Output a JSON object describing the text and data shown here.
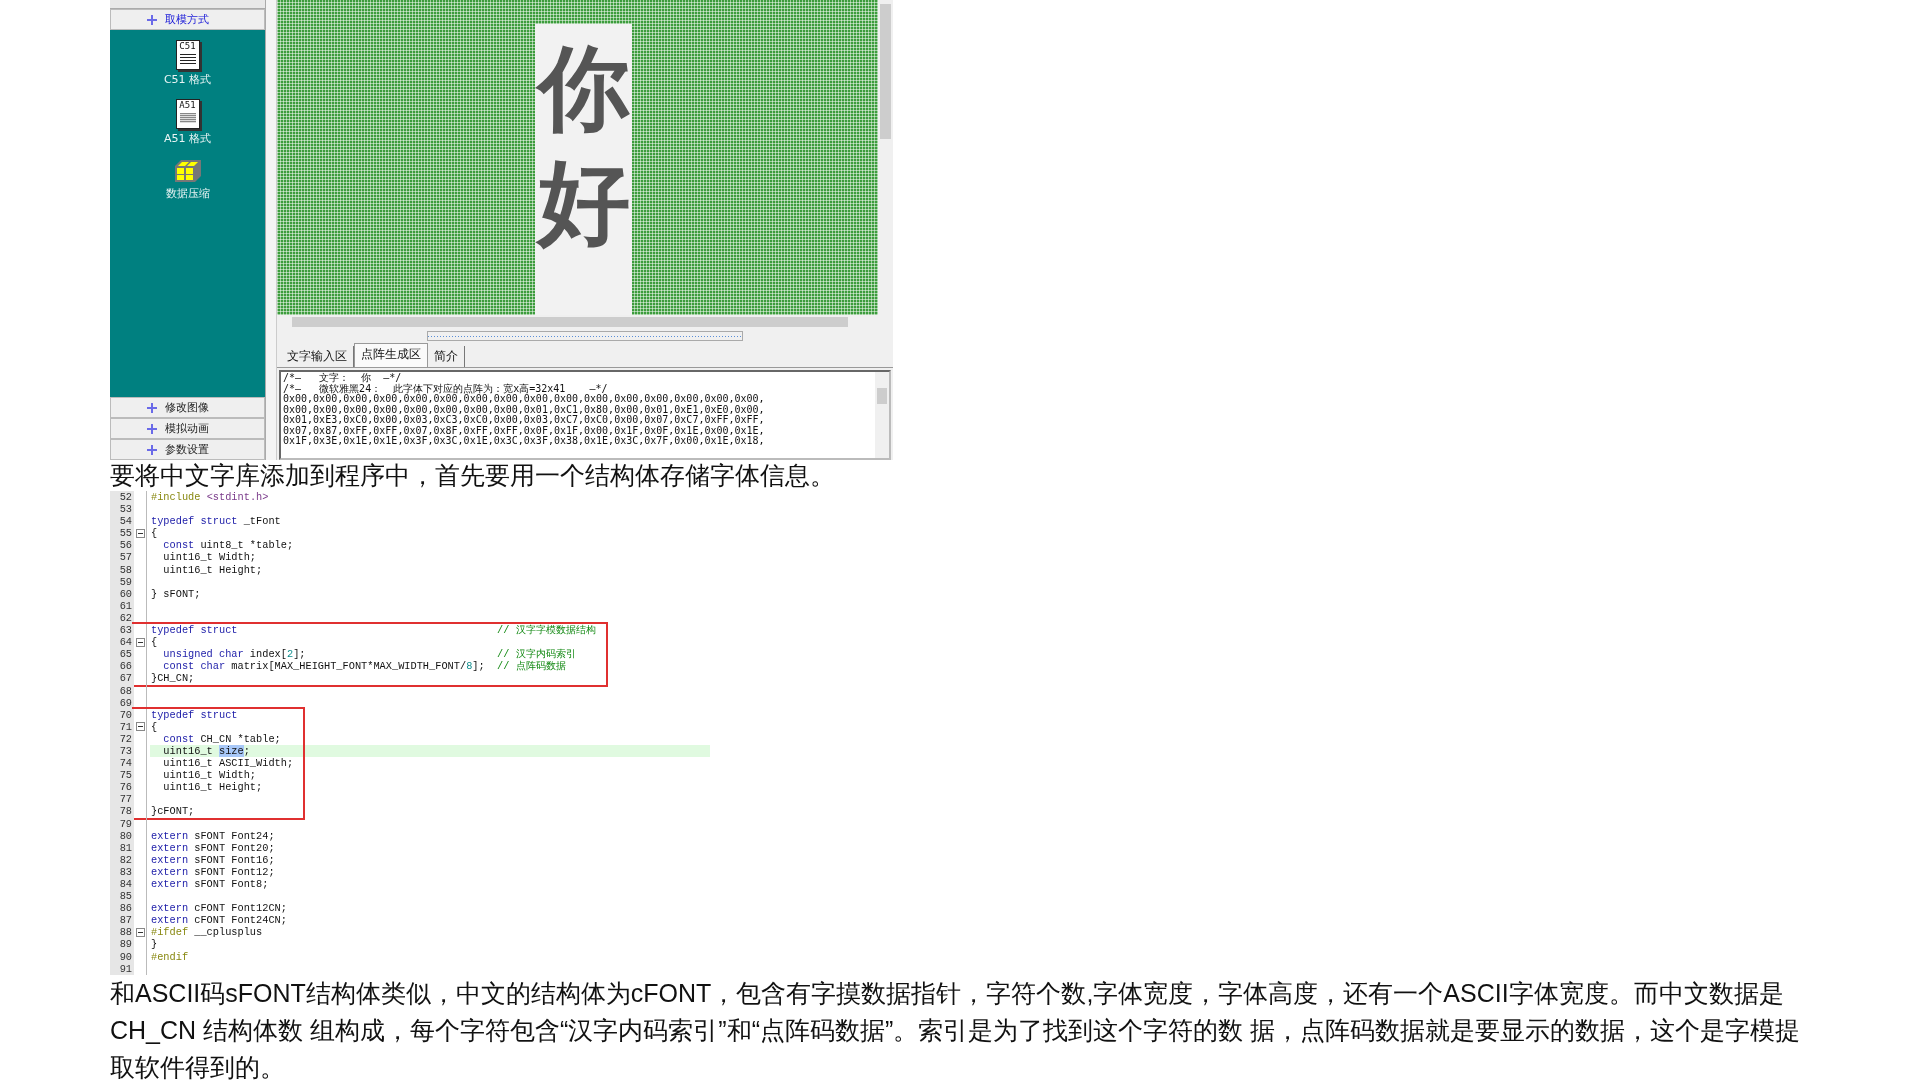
{
  "tool_window": {
    "sections": [
      {
        "label": "取模方式",
        "expanded": true,
        "tools": [
          {
            "kind": "c51",
            "icon_text": "C51",
            "label": "C51 格式"
          },
          {
            "kind": "a51",
            "icon_text": "A51",
            "label": "A51 格式"
          },
          {
            "kind": "compress",
            "label": "数据压缩"
          }
        ]
      },
      {
        "label": "修改图像",
        "expanded": false
      },
      {
        "label": "模拟动画",
        "expanded": false
      },
      {
        "label": "参数设置",
        "expanded": false
      }
    ],
    "preview": {
      "characters": [
        "你",
        "好"
      ]
    },
    "tabs": [
      {
        "label": "文字输入区",
        "selected": false
      },
      {
        "label": "点阵生成区",
        "selected": true
      },
      {
        "label": "简介",
        "selected": false
      }
    ],
    "output_lines": [
      "/*—   文字：  你  —*/",
      "/*—   微软雅黑24：  此字体下对应的点阵为：宽x高=32x41    —*/",
      "0x00,0x00,0x00,0x00,0x00,0x00,0x00,0x00,0x00,0x00,0x00,0x00,0x00,0x00,0x00,0x00,",
      "0x00,0x00,0x00,0x00,0x00,0x00,0x00,0x00,0x01,0xC1,0x80,0x00,0x01,0xE1,0xE0,0x00,",
      "0x01,0xE3,0xC0,0x00,0x03,0xC3,0xC0,0x00,0x03,0xC7,0xC0,0x00,0x07,0xC7,0xFF,0xFF,",
      "0x07,0x87,0xFF,0xFF,0x07,0x8F,0xFF,0xFF,0x0F,0x1F,0x00,0x1F,0x0F,0x1E,0x00,0x1E,",
      "0x1F,0x3E,0x1E,0x1E,0x3F,0x3C,0x1E,0x3C,0x3F,0x38,0x1E,0x3C,0x7F,0x00,0x1E,0x18,"
    ]
  },
  "intro": "要将中文字库添加到程序中，首先要用一个结构体存储字体信息。",
  "code": {
    "blocks": [
      {
        "boxed": false,
        "lines": [
          {
            "number": "52",
            "fold": false,
            "highlighted": false,
            "indented": false,
            "segments": [
              {
                "kind": "preproc",
                "text": "#include "
              },
              {
                "kind": "header",
                "text": "<stdint.h>"
              }
            ]
          },
          {
            "number": "53",
            "fold": false,
            "highlighted": false
          },
          {
            "number": "54",
            "fold": false,
            "highlighted": false,
            "indented": false,
            "segments": [
              {
                "kind": "keyword",
                "text": "typedef struct"
              },
              {
                "kind": "plain",
                "text": " _tFont"
              }
            ]
          },
          {
            "number": "55",
            "fold": true,
            "highlighted": false,
            "indented": false,
            "segments": [
              {
                "kind": "plain",
                "text": "{"
              }
            ]
          },
          {
            "number": "56",
            "fold": false,
            "highlighted": false,
            "indented": true,
            "segments": [
              {
                "kind": "keyword",
                "text": "const"
              },
              {
                "kind": "plain",
                "text": " uint8_t *table;"
              }
            ]
          },
          {
            "number": "57",
            "fold": false,
            "highlighted": false,
            "indented": true,
            "segments": [
              {
                "kind": "plain",
                "text": "uint16_t Width;"
              }
            ]
          },
          {
            "number": "58",
            "fold": false,
            "highlighted": false,
            "indented": true,
            "segments": [
              {
                "kind": "plain",
                "text": "uint16_t Height;"
              }
            ]
          },
          {
            "number": "59",
            "fold": false,
            "highlighted": false
          },
          {
            "number": "60",
            "fold": false,
            "highlighted": false,
            "indented": false,
            "segments": [
              {
                "kind": "plain",
                "text": "} sFONT;"
              }
            ]
          },
          {
            "number": "61",
            "fold": false,
            "highlighted": false
          },
          {
            "number": "62",
            "fold": false,
            "highlighted": false
          }
        ]
      },
      {
        "boxed": true,
        "lines": [
          {
            "number": "63",
            "fold": false,
            "highlighted": false,
            "indented": false,
            "segments": [
              {
                "kind": "keyword",
                "text": "typedef struct"
              },
              {
                "kind": "comment",
                "text": "                                          // 汉字字模数据结构"
              }
            ]
          },
          {
            "number": "64",
            "fold": true,
            "highlighted": false,
            "indented": false,
            "segments": [
              {
                "kind": "plain",
                "text": "{"
              }
            ]
          },
          {
            "number": "65",
            "fold": false,
            "highlighted": false,
            "indented": true,
            "segments": [
              {
                "kind": "keyword",
                "text": "unsigned char"
              },
              {
                "kind": "plain",
                "text": " index["
              },
              {
                "kind": "number",
                "text": "2"
              },
              {
                "kind": "plain",
                "text": "];"
              },
              {
                "kind": "comment",
                "text": "                               // 汉字内码索引"
              }
            ]
          },
          {
            "number": "66",
            "fold": false,
            "highlighted": false,
            "indented": true,
            "segments": [
              {
                "kind": "keyword",
                "text": "const char"
              },
              {
                "kind": "plain",
                "text": " matrix[MAX_HEIGHT_FONT*MAX_WIDTH_FONT/"
              },
              {
                "kind": "number",
                "text": "8"
              },
              {
                "kind": "plain",
                "text": "];"
              },
              {
                "kind": "comment",
                "text": "  // 点阵码数据"
              }
            ]
          },
          {
            "number": "67",
            "fold": false,
            "highlighted": false,
            "indented": false,
            "segments": [
              {
                "kind": "plain",
                "text": "}CH_CN;"
              }
            ]
          }
        ]
      },
      {
        "boxed": false,
        "lines": [
          {
            "number": "68",
            "fold": false,
            "highlighted": false
          },
          {
            "number": "69",
            "fold": false,
            "highlighted": false
          }
        ]
      },
      {
        "boxed": true,
        "lines": [
          {
            "number": "70",
            "fold": false,
            "highlighted": false,
            "indented": false,
            "segments": [
              {
                "kind": "keyword",
                "text": "typedef struct"
              }
            ]
          },
          {
            "number": "71",
            "fold": true,
            "highlighted": false,
            "indented": false,
            "segments": [
              {
                "kind": "plain",
                "text": "{"
              }
            ]
          },
          {
            "number": "72",
            "fold": false,
            "highlighted": false,
            "indented": true,
            "segments": [
              {
                "kind": "keyword",
                "text": "const"
              },
              {
                "kind": "plain",
                "text": " CH_CN *table;"
              }
            ]
          },
          {
            "number": "73",
            "fold": false,
            "highlighted": true,
            "indented": true,
            "segments": [
              {
                "kind": "plain",
                "text": "uint16_t "
              },
              {
                "kind": "selected",
                "text": "size"
              },
              {
                "kind": "plain",
                "text": ";"
              }
            ]
          },
          {
            "number": "74",
            "fold": false,
            "highlighted": false,
            "indented": true,
            "segments": [
              {
                "kind": "plain",
                "text": "uint16_t ASCII_Width;"
              }
            ]
          },
          {
            "number": "75",
            "fold": false,
            "highlighted": false,
            "indented": true,
            "segments": [
              {
                "kind": "plain",
                "text": "uint16_t Width;"
              }
            ]
          },
          {
            "number": "76",
            "fold": false,
            "highlighted": false,
            "indented": true,
            "segments": [
              {
                "kind": "plain",
                "text": "uint16_t Height;"
              }
            ]
          },
          {
            "number": "77",
            "fold": false,
            "highlighted": false
          },
          {
            "number": "78",
            "fold": false,
            "highlighted": false,
            "indented": false,
            "segments": [
              {
                "kind": "plain",
                "text": "}cFONT;"
              }
            ]
          }
        ]
      },
      {
        "boxed": false,
        "lines": [
          {
            "number": "79",
            "fold": false,
            "highlighted": false
          },
          {
            "number": "80",
            "fold": false,
            "highlighted": false,
            "indented": false,
            "segments": [
              {
                "kind": "keyword",
                "text": "extern"
              },
              {
                "kind": "plain",
                "text": " sFONT Font24;"
              }
            ]
          },
          {
            "number": "81",
            "fold": false,
            "highlighted": false,
            "indented": false,
            "segments": [
              {
                "kind": "keyword",
                "text": "extern"
              },
              {
                "kind": "plain",
                "text": " sFONT Font20;"
              }
            ]
          },
          {
            "number": "82",
            "fold": false,
            "highlighted": false,
            "indented": false,
            "segments": [
              {
                "kind": "keyword",
                "text": "extern"
              },
              {
                "kind": "plain",
                "text": " sFONT Font16;"
              }
            ]
          },
          {
            "number": "83",
            "fold": false,
            "highlighted": false,
            "indented": false,
            "segments": [
              {
                "kind": "keyword",
                "text": "extern"
              },
              {
                "kind": "plain",
                "text": " sFONT Font12;"
              }
            ]
          },
          {
            "number": "84",
            "fold": false,
            "highlighted": false,
            "indented": false,
            "segments": [
              {
                "kind": "keyword",
                "text": "extern"
              },
              {
                "kind": "plain",
                "text": " sFONT Font8;"
              }
            ]
          },
          {
            "number": "85",
            "fold": false,
            "highlighted": false
          },
          {
            "number": "86",
            "fold": false,
            "highlighted": false,
            "indented": false,
            "segments": [
              {
                "kind": "keyword",
                "text": "extern"
              },
              {
                "kind": "plain",
                "text": " cFONT Font12CN;"
              }
            ]
          },
          {
            "number": "87",
            "fold": false,
            "highlighted": false,
            "indented": false,
            "segments": [
              {
                "kind": "keyword",
                "text": "extern"
              },
              {
                "kind": "plain",
                "text": " cFONT Font24CN;"
              }
            ]
          },
          {
            "number": "88",
            "fold": true,
            "highlighted": false,
            "indented": false,
            "segments": [
              {
                "kind": "preproc",
                "text": "#ifdef"
              },
              {
                "kind": "plain",
                "text": " __cplusplus"
              }
            ]
          },
          {
            "number": "89",
            "fold": false,
            "highlighted": false,
            "indented": false,
            "segments": [
              {
                "kind": "plain",
                "text": "}"
              }
            ]
          },
          {
            "number": "90",
            "fold": false,
            "highlighted": false,
            "indented": false,
            "segments": [
              {
                "kind": "preproc",
                "text": "#endif"
              }
            ]
          },
          {
            "number": "91",
            "fold": false,
            "highlighted": false
          }
        ]
      }
    ]
  },
  "paragraph": " 和ASCII码sFONT结构体类似，中文的结构体为cFONT，包含有字摸数据指针，字符个数,字体宽度，字体高度，还有一个ASCII字体宽度。而中文数据是CH_CN 结构体数 组构成，每个字符包含“汉字内码索引”和“点阵码数据”。索引是为了找到这个字符的数 据，点阵码数据就是要显示的数据，这个是字模提取软件得到的。"
}
